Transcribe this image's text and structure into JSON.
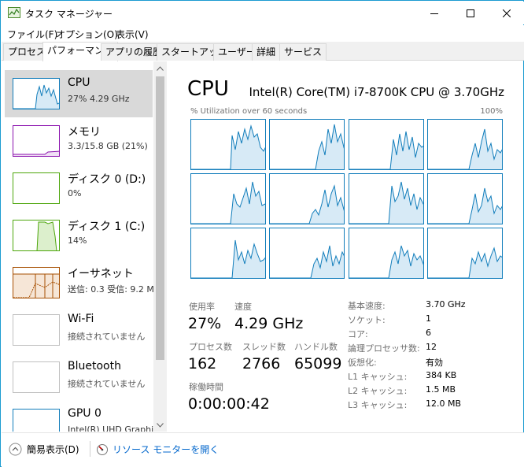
{
  "window": {
    "title": "タスク マネージャー"
  },
  "menu": [
    "ファイル(F)",
    "オプション(O)",
    "表示(V)"
  ],
  "tabs": [
    {
      "label": "プロセス",
      "active": false
    },
    {
      "label": "パフォーマンス",
      "active": true
    },
    {
      "label": "アプリの履歴",
      "active": false
    },
    {
      "label": "スタートアップ",
      "active": false
    },
    {
      "label": "ユーザー",
      "active": false
    },
    {
      "label": "詳細",
      "active": false
    },
    {
      "label": "サービス",
      "active": false
    }
  ],
  "resources": [
    {
      "name": "CPU",
      "sub": "27%  4.29 GHz",
      "color": "#117dbb",
      "selected": true
    },
    {
      "name": "メモリ",
      "sub": "3.3/15.8 GB (21%)",
      "color": "#8b12ae",
      "selected": false
    },
    {
      "name": "ディスク 0 (D:)",
      "sub": "0%",
      "color": "#4da60c",
      "selected": false
    },
    {
      "name": "ディスク 1 (C:)",
      "sub": "14%",
      "color": "#4da60c",
      "selected": false
    },
    {
      "name": "イーサネット",
      "sub": "送信: 0.3  受信: 9.2 M",
      "color": "#a74f01",
      "selected": false
    },
    {
      "name": "Wi-Fi",
      "sub": "接続されていません",
      "color": "#c0c0c0",
      "selected": false
    },
    {
      "name": "Bluetooth",
      "sub": "接続されていません",
      "color": "#c0c0c0",
      "selected": false
    },
    {
      "name": "GPU 0",
      "sub": "Intel(R) UHD Graphic",
      "color": "#117dbb",
      "selected": false
    }
  ],
  "main": {
    "title": "CPU",
    "model": "Intel(R) Core(TM) i7-8700K CPU @ 3.70GHz",
    "util_label": "% Utilization over 60 seconds",
    "util_max": "100%",
    "stats": {
      "usage_label": "使用率",
      "usage_value": "27%",
      "speed_label": "速度",
      "speed_value": "4.29 GHz",
      "process_label": "プロセス数",
      "process_value": "162",
      "thread_label": "スレッド数",
      "thread_value": "2766",
      "handle_label": "ハンドル数",
      "handle_value": "65099",
      "uptime_label": "稼働時間",
      "uptime_value": "0:00:00:42"
    },
    "specs": [
      {
        "label": "基本速度:",
        "value": "3.70 GHz"
      },
      {
        "label": "ソケット:",
        "value": "1"
      },
      {
        "label": "コア:",
        "value": "6"
      },
      {
        "label": "論理プロセッサ数:",
        "value": "12"
      },
      {
        "label": "仮想化:",
        "value": "有効"
      },
      {
        "label": "L1 キャッシュ:",
        "value": "384 KB"
      },
      {
        "label": "L2 キャッシュ:",
        "value": "1.5 MB"
      },
      {
        "label": "L3 キャッシュ:",
        "value": "12.0 MB"
      }
    ]
  },
  "footer": {
    "fewer_details": "簡易表示(D)",
    "open_monitor": "リソース モニターを開く"
  }
}
